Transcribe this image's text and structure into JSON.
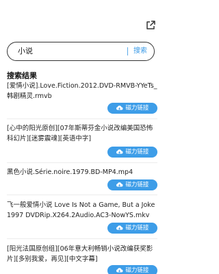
{
  "search": {
    "value": "小说",
    "button_label": "搜索"
  },
  "results_title": "搜索结果",
  "results": [
    {
      "title": "[爱情小说].Love.Fiction.2012.DVD-RMVB-YYeTs_韩剧精灵.rmvb",
      "button": "磁力链接"
    },
    {
      "title": "[心中的阳光原创][07年斯蒂芬金小说改编美国恐怖科幻片][迷雾震魂][英语中字]",
      "button": "磁力链接"
    },
    {
      "title": "黑色小说.Série.noire.1979.BD-MP4.mp4",
      "button": "磁力链接"
    },
    {
      "title": "飞一般爱情小说 Love Is Not a Game, But a Joke 1997 DVDRip.X264.2Audio.AC3-NowYS.mkv",
      "button": "磁力链接"
    },
    {
      "title": "[阳光法国原创组][06年意大利畅销小说改编获奖影片][多别我爱，再见][中文字幕]",
      "button": "磁力链接"
    }
  ],
  "colors": {
    "accent": "#3d9de8",
    "border": "#333333"
  },
  "icons": {
    "share": "share-icon",
    "cloud": "cloud-download-icon"
  }
}
